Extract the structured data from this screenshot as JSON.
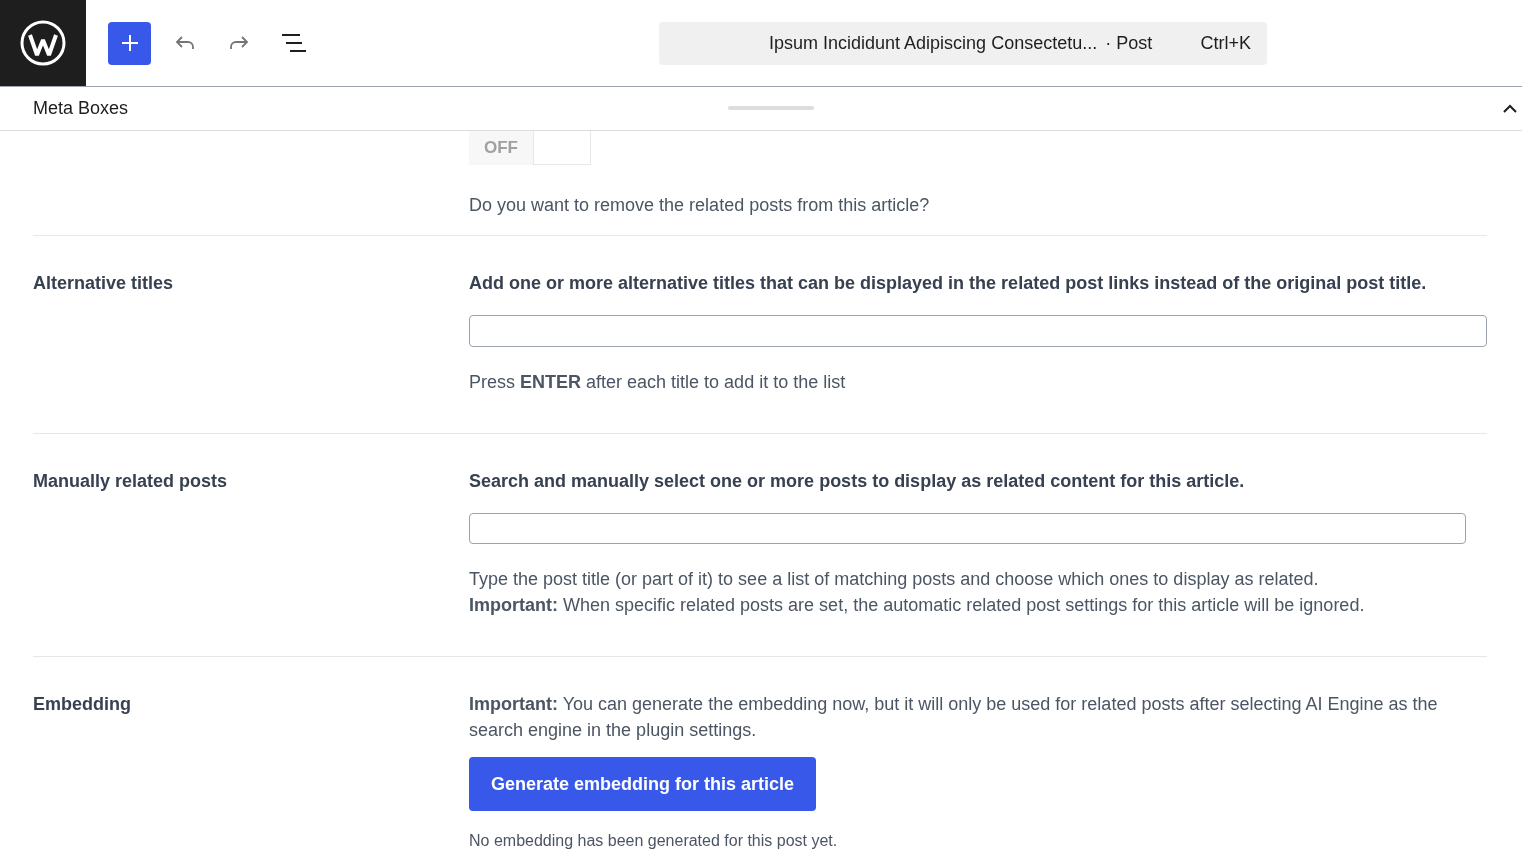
{
  "header": {
    "document_title": "Ipsum Incididunt Adipiscing Consectetu...",
    "document_type": "· Post",
    "shortcut": "Ctrl+K"
  },
  "meta_boxes": {
    "title": "Meta Boxes",
    "expanded": true
  },
  "sections": [
    {
      "kind": "toggle",
      "toggle": {
        "on": false,
        "label": "OFF"
      },
      "help": "Do you want to remove the related posts from this article?"
    },
    {
      "kind": "field",
      "label": "Alternative titles",
      "description": "Add one or more alternative titles that can be displayed in the related post links instead of the original post title.",
      "wide": true,
      "help": [
        "Press **ENTER** after each title to add it to the list"
      ]
    },
    {
      "kind": "field",
      "label": "Manually related posts",
      "description": "Search and manually select one or more posts to display as related content for this article.",
      "wide": false,
      "help": [
        "Type the post title (or part of it) to see a list of matching posts and choose which ones to display as related.",
        "**Important:** When specific related posts are set, the automatic related post settings for this article will be ignored."
      ]
    },
    {
      "kind": "button",
      "label": "Embedding",
      "description": "**Important:** You can generate the embedding now, but it will only be used for related posts after selecting AI Engine as the search engine in the plugin settings.",
      "button": "Generate embedding for this article",
      "help": "No embedding has been generated for this post yet."
    }
  ]
}
